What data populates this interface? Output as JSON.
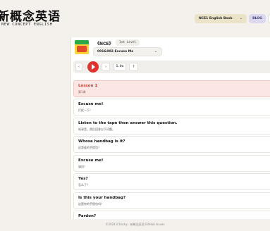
{
  "header": {
    "logo_cn": "新概念英语",
    "logo_en": "NEW CONCEPT ENGLISH",
    "book_select": "NCE1 English Book",
    "blog_label": "BLOG"
  },
  "book": {
    "title": "《NCE》",
    "level": "1st Level",
    "lesson_select": "001&002-Excuse Me"
  },
  "player": {
    "speed": "1.0x"
  },
  "lines": [
    {
      "en": "Lesson 1",
      "zh": "第1课",
      "active": true
    },
    {
      "en": "Excuse me!",
      "zh": "打扰一下！"
    },
    {
      "en": "Listen to the tape then answer this question.",
      "zh": "听录音，然后回答以下问题。"
    },
    {
      "en": "Whose handbag is it?",
      "zh": "这是谁的手提包？"
    },
    {
      "en": "Excuse me!",
      "zh": "请问！"
    },
    {
      "en": "Yes?",
      "zh": "怎么了？"
    },
    {
      "en": "Is this your handbag?",
      "zh": "这是你的手提包吗？"
    },
    {
      "en": "Pardon?",
      "zh": ""
    }
  ],
  "footer": "©2024 iChochy · 新概念英语 GitHub Issues"
}
